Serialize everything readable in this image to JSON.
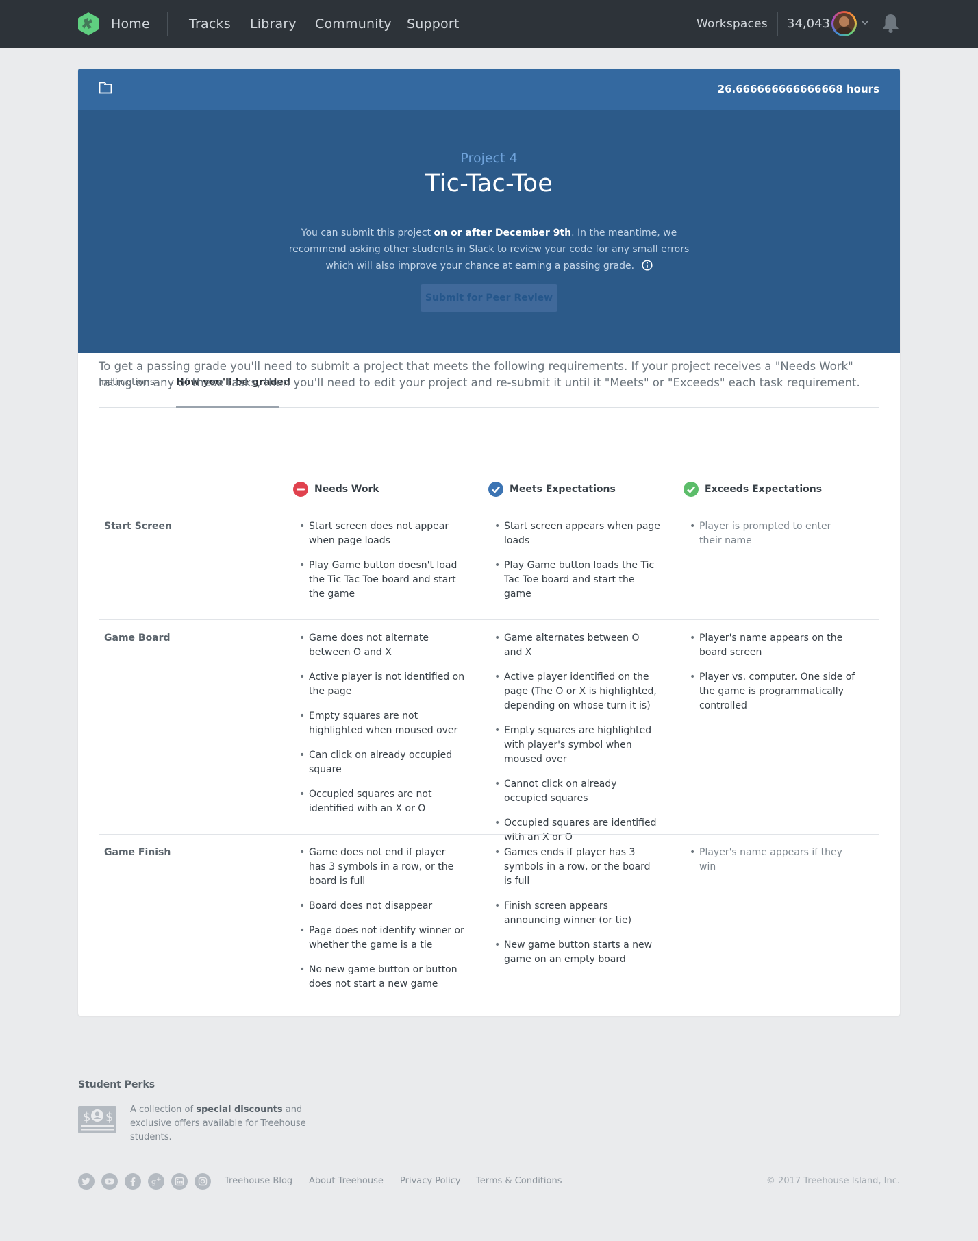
{
  "nav": {
    "home": "Home",
    "links": [
      "Tracks",
      "Library",
      "Community",
      "Support"
    ],
    "workspaces": "Workspaces",
    "points": "34,043"
  },
  "project": {
    "hours": "26.666666666666668 hours",
    "kicker": "Project 4",
    "title": "Tic-Tac-Toe",
    "desc_pre": "You can submit this project ",
    "desc_bold": "on or after December 9th",
    "desc_post": ". In the meantime, we recommend asking other students in Slack to review your code for any small errors which will also improve your chance at earning a passing grade.",
    "submit_label": "Submit for Peer Review"
  },
  "tabs": {
    "instructions": "Instructions",
    "graded": "How you'll be graded"
  },
  "intro": "To get a passing grade you'll need to submit a project that meets the following requirements. If your project receives a \"Needs Work\" rating on any of these tasks, then you'll need to edit your project and re-submit it until it \"Meets\" or \"Exceeds\" each task requirement.",
  "columns": {
    "needs": "Needs Work",
    "meets": "Meets Expectations",
    "exceeds": "Exceeds Expectations",
    "colors": {
      "needs": "#e0424e",
      "meets": "#3c74b3",
      "exceeds": "#5cbd6a"
    }
  },
  "rows": [
    {
      "title": "Start Screen",
      "needs": [
        "Start screen does not appear when page loads",
        "Play Game button doesn't load the Tic Tac Toe board and start the game"
      ],
      "meets": [
        "Start screen appears when page loads",
        "Play Game button loads the Tic Tac Toe board and start the game"
      ],
      "exceeds": [
        "Player is prompted to enter their name"
      ]
    },
    {
      "title": "Game Board",
      "needs": [
        "Game does not alternate between O and X",
        "Active player is not identified on the page",
        "Empty squares are not highlighted when moused over",
        "Can click on already occupied square",
        "Occupied squares are not identified with an X or O"
      ],
      "meets": [
        "Game alternates between O and X",
        "Active player identified on the page (The O or X is highlighted, depending on whose turn it is)",
        "Empty squares are highlighted with player's symbol when moused over",
        "Cannot click on already occupied squares",
        "Occupied squares are identified with an X or O"
      ],
      "exceeds": [
        "Player's name appears on the board screen",
        "Player vs. computer. One side of the game is programmatically controlled"
      ]
    },
    {
      "title": "Game Finish",
      "needs": [
        "Game does not end if player has 3 symbols in a row, or the board is full",
        "Board does not disappear",
        "Page does not identify winner or whether the game is a tie",
        "No new game button or button does not start a new game"
      ],
      "meets": [
        "Games ends if player has 3 symbols in a row, or the board is full",
        "Finish screen appears announcing winner (or tie)",
        "New game button starts a new game on an empty board"
      ],
      "exceeds": [
        "Player's name appears if they win"
      ]
    }
  ],
  "footer": {
    "perks_title": "Student Perks",
    "perks_pre": "A collection of ",
    "perks_bold": "special discounts",
    "perks_post": " and exclusive offers available for Treehouse students.",
    "social_icons": [
      "twitter-icon",
      "youtube-icon",
      "facebook-icon",
      "google-plus-icon",
      "linkedin-icon",
      "instagram-icon"
    ],
    "links": [
      "Treehouse Blog",
      "About Treehouse",
      "Privacy Policy",
      "Terms & Conditions"
    ],
    "copyright": "© 2017 Treehouse Island, Inc."
  }
}
